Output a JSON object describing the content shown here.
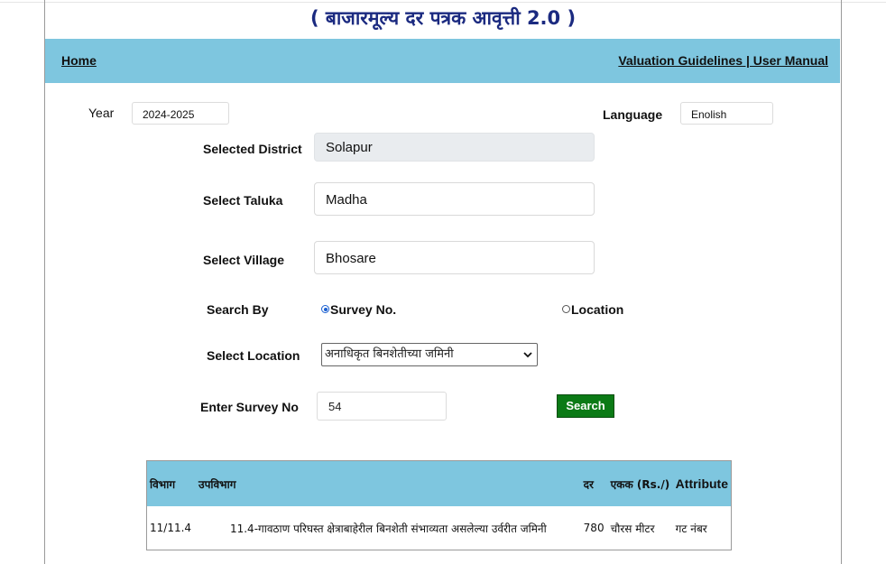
{
  "page": {
    "title": "( बाजारमूल्य दर पत्रक आवृत्ती 2.0 )"
  },
  "nav": {
    "home": "Home",
    "right_links": "Valuation Guidelines | User Manual"
  },
  "filters": {
    "year_label": "Year",
    "year_value": "2024-2025",
    "language_label": "Language",
    "language_value": "Enolish"
  },
  "form": {
    "district_label": "Selected District",
    "district_value": "Solapur",
    "taluka_label": "Select Taluka",
    "taluka_value": "Madha",
    "village_label": "Select Village",
    "village_value": "Bhosare",
    "search_by_label": "Search By",
    "search_by_options": [
      "Survey No.",
      "Location"
    ],
    "search_by_selected": "Survey No.",
    "location_label": "Select Location",
    "location_value": "अनाधिकृत बिनशेतीच्या जमिनी",
    "survey_label": "Enter Survey No",
    "survey_value": "54",
    "search_button": "Search"
  },
  "results": {
    "headers": {
      "division": "विभाग",
      "subdivision": "उपविभाग",
      "rate": "दर",
      "unit": "एकक (Rs./)",
      "attribute": "Attribute"
    },
    "rows": [
      {
        "division": "11/11.4",
        "subdivision": "11.4-गावठाण परिघस्त क्षेत्राबाहेरील बिनशेती संभाव्यता असलेल्या उर्वरीत जमिनी",
        "rate": "780",
        "unit": "चौरस मीटर",
        "attribute": "गट नंबर"
      }
    ]
  },
  "colors": {
    "navbar": "#7ec6df",
    "title": "#1b2a80",
    "search_button": "#0b7a16"
  }
}
